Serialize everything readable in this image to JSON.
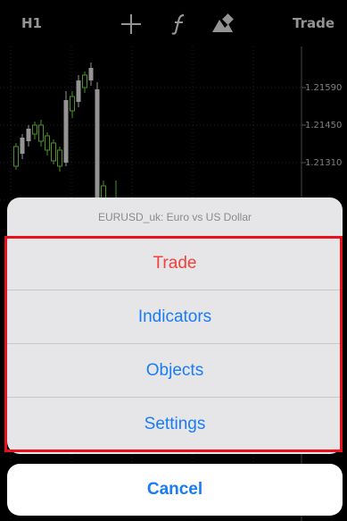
{
  "toolbar": {
    "timeframe": "H1",
    "trade_label": "Trade",
    "icons": [
      "crosshair-icon",
      "function-icon",
      "objects-icon"
    ]
  },
  "chart": {
    "price_labels": [
      "1.21590",
      "1.21450",
      "1.21310"
    ]
  },
  "action_sheet": {
    "title": "EURUSD_uk: Euro vs US Dollar",
    "items": [
      {
        "label": "Trade",
        "color": "#f0413b"
      },
      {
        "label": "Indicators",
        "color": "#1a7cf5"
      },
      {
        "label": "Objects",
        "color": "#1a7cf5"
      },
      {
        "label": "Settings",
        "color": "#1a7cf5"
      }
    ],
    "cancel_label": "Cancel"
  },
  "colors": {
    "accent": "#1a7cf5",
    "destructive": "#f0413b",
    "highlight_border": "#e8101a",
    "candle_up": "#ffffff",
    "candle_down": "#7fff3c"
  }
}
